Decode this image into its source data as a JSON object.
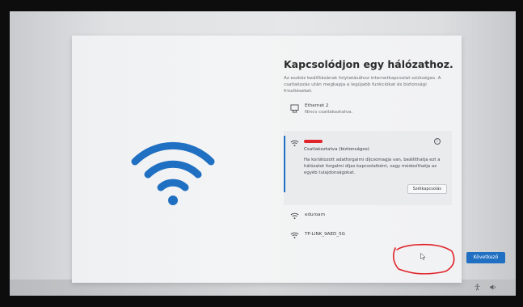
{
  "header": {
    "title": "Kapcsolódjon egy hálózathoz.",
    "subtitle": "Az eszköz beállításának folytatásához internetkapcsolat szükséges. A csatlakozás után megkapja a legújabb funkciókat és biztonsági frissítéseket."
  },
  "ethernet": {
    "name": "Ethernet 2",
    "status": "Nincs csatlakoztatva."
  },
  "selected_network": {
    "status": "Csatlakoztatva (biztonságos)",
    "message": "Ha korlátozott adatforgalmi díjcsomagja van, beállíthatja ezt a hálózatot forgalmi díjas kapcsolatként, vagy módosíthatja az egyéb tulajdonságokat.",
    "disconnect_label": "Szétkapcsolás",
    "info_glyph": "i"
  },
  "networks": [
    {
      "name": "eduroam"
    },
    {
      "name": "TP-LINK_9AED_5G"
    }
  ],
  "footer": {
    "next_label": "Következő"
  },
  "colors": {
    "accent": "#1f6fc2",
    "annotation": "#e0242b"
  },
  "icons": [
    "wifi-icon",
    "ethernet-icon",
    "info-icon",
    "accessibility-icon",
    "volume-icon"
  ]
}
